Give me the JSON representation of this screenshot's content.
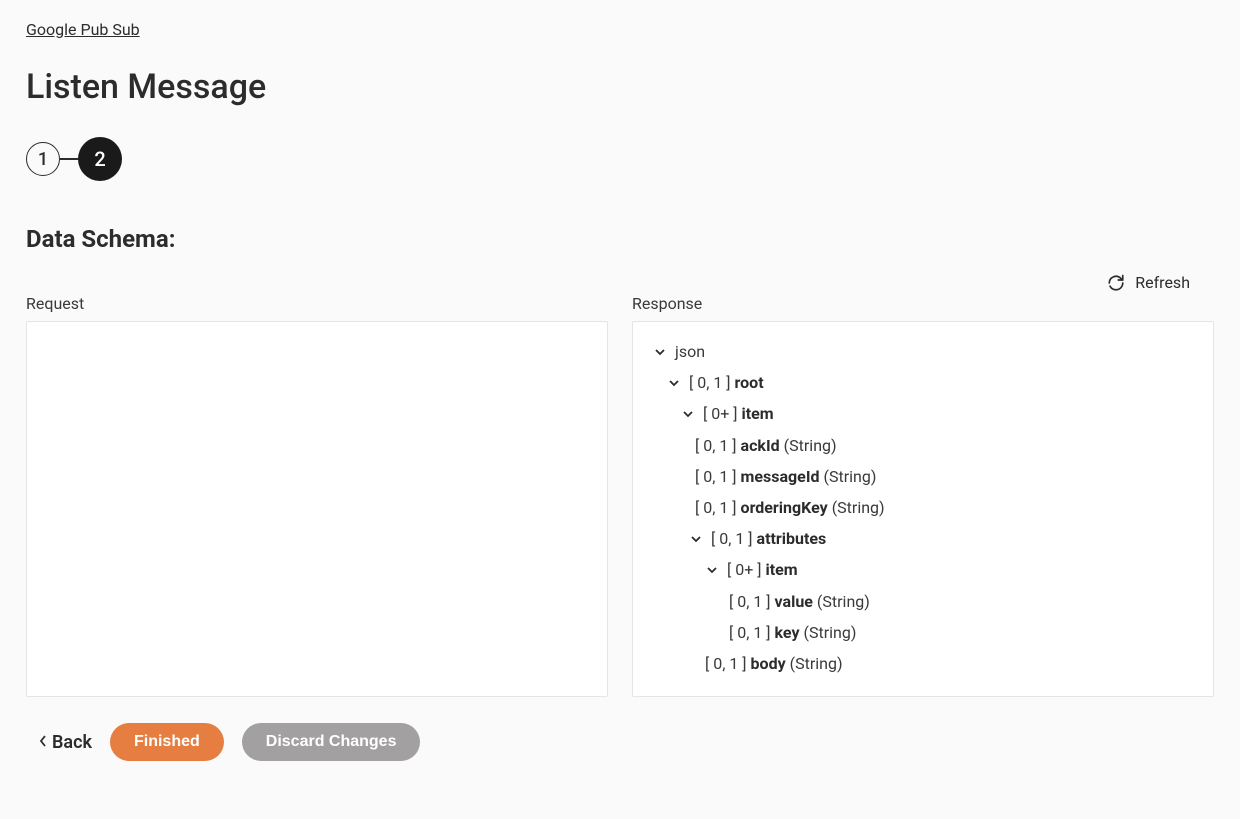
{
  "breadcrumb": {
    "label": "Google Pub Sub"
  },
  "page": {
    "title": "Listen Message"
  },
  "stepper": {
    "step1": "1",
    "step2": "2"
  },
  "section": {
    "title": "Data Schema:"
  },
  "refresh": {
    "label": "Refresh"
  },
  "panels": {
    "request": {
      "label": "Request"
    },
    "response": {
      "label": "Response"
    }
  },
  "tree": {
    "json": "json",
    "root": {
      "card": "[ 0, 1 ]",
      "name": "root"
    },
    "item1": {
      "card": "[ 0+ ]",
      "name": "item"
    },
    "ackId": {
      "card": "[ 0, 1 ]",
      "name": "ackId",
      "type": "(String)"
    },
    "messageId": {
      "card": "[ 0, 1 ]",
      "name": "messageId",
      "type": "(String)"
    },
    "orderingKey": {
      "card": "[ 0, 1 ]",
      "name": "orderingKey",
      "type": "(String)"
    },
    "attributes": {
      "card": "[ 0, 1 ]",
      "name": "attributes"
    },
    "item2": {
      "card": "[ 0+ ]",
      "name": "item"
    },
    "value": {
      "card": "[ 0, 1 ]",
      "name": "value",
      "type": "(String)"
    },
    "key": {
      "card": "[ 0, 1 ]",
      "name": "key",
      "type": "(String)"
    },
    "body": {
      "card": "[ 0, 1 ]",
      "name": "body",
      "type": "(String)"
    }
  },
  "footer": {
    "back": "Back",
    "finished": "Finished",
    "discard": "Discard Changes"
  }
}
